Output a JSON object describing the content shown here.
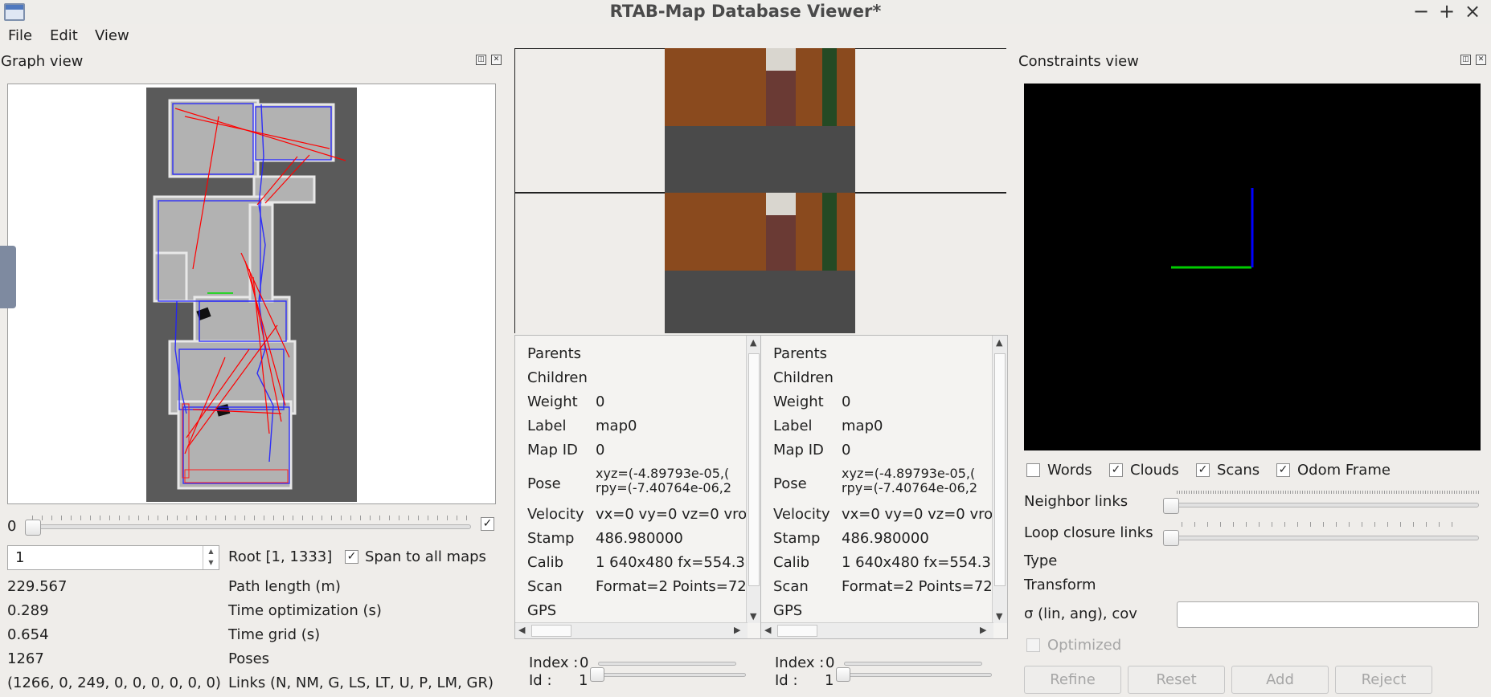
{
  "window": {
    "title": "RTAB-Map Database Viewer*",
    "minimize": "−",
    "maximize": "+",
    "close": "×"
  },
  "menu": [
    "File",
    "Edit",
    "View"
  ],
  "graph_view": {
    "title": "Graph view",
    "slider_min_label": "0",
    "slider_checked": true,
    "root_spin_value": "1",
    "root_label": "Root [1, 1333]",
    "span_all_maps_label": "Span to all maps",
    "span_all_maps_checked": true,
    "stats": [
      {
        "value": "229.567",
        "label": "Path length (m)"
      },
      {
        "value": "0.289",
        "label": "Time optimization (s)"
      },
      {
        "value": "0.654",
        "label": "Time grid (s)"
      },
      {
        "value": "1267",
        "label": "Poses"
      },
      {
        "value": "(1266, 0, 249, 0, 0, 0, 0, 0, 0)",
        "label": "Links (N, NM, G, LS, LT, U, P, LM, GR)"
      }
    ]
  },
  "node_info_left": {
    "rows": [
      {
        "key": "Parents",
        "value": ""
      },
      {
        "key": "Children",
        "value": ""
      },
      {
        "key": "Weight",
        "value": "0"
      },
      {
        "key": "Label",
        "value": "map0"
      },
      {
        "key": "Map ID",
        "value": "0"
      },
      {
        "key": "Pose",
        "value": "xyz=(-4.89793e-05,(",
        "value2": "rpy=(-7.40764e-06,2"
      },
      {
        "key": "Velocity",
        "value": "vx=0 vy=0 vz=0 vro"
      },
      {
        "key": "Stamp",
        "value": "486.980000"
      },
      {
        "key": "Calib",
        "value": "1 640x480 fx=554.3"
      },
      {
        "key": "Scan",
        "value": "Format=2 Points=72"
      },
      {
        "key": "GPS",
        "value": ""
      }
    ],
    "index_label": "Index :",
    "index_value": "0",
    "id_label": "Id :",
    "id_value": "1"
  },
  "node_info_right": {
    "rows": [
      {
        "key": "Parents",
        "value": ""
      },
      {
        "key": "Children",
        "value": ""
      },
      {
        "key": "Weight",
        "value": "0"
      },
      {
        "key": "Label",
        "value": "map0"
      },
      {
        "key": "Map ID",
        "value": "0"
      },
      {
        "key": "Pose",
        "value": "xyz=(-4.89793e-05,(",
        "value2": "rpy=(-7.40764e-06,2"
      },
      {
        "key": "Velocity",
        "value": "vx=0 vy=0 vz=0 vro"
      },
      {
        "key": "Stamp",
        "value": "486.980000"
      },
      {
        "key": "Calib",
        "value": "1 640x480 fx=554.3"
      },
      {
        "key": "Scan",
        "value": "Format=2 Points=72"
      },
      {
        "key": "GPS",
        "value": ""
      }
    ],
    "index_label": "Index :",
    "index_value": "0",
    "id_label": "Id :",
    "id_value": "1"
  },
  "constraints_view": {
    "title": "Constraints view",
    "options": [
      {
        "label": "Words",
        "checked": false
      },
      {
        "label": "Clouds",
        "checked": true
      },
      {
        "label": "Scans",
        "checked": true
      },
      {
        "label": "Odom Frame",
        "checked": true
      }
    ],
    "neighbor_links_label": "Neighbor links",
    "loop_closure_links_label": "Loop closure links",
    "type_label": "Type",
    "transform_label": "Transform",
    "sigma_label": "σ (lin, ang), cov",
    "sigma_value": "",
    "optimized_label": "Optimized",
    "buttons": {
      "refine": "Refine",
      "reset": "Reset",
      "add": "Add",
      "reject": "Reject"
    }
  },
  "colors": {
    "loop_closure": "#ff0000",
    "path": "#2020ff",
    "axis_x": "#00cc00",
    "axis_y": "#0000ff"
  }
}
